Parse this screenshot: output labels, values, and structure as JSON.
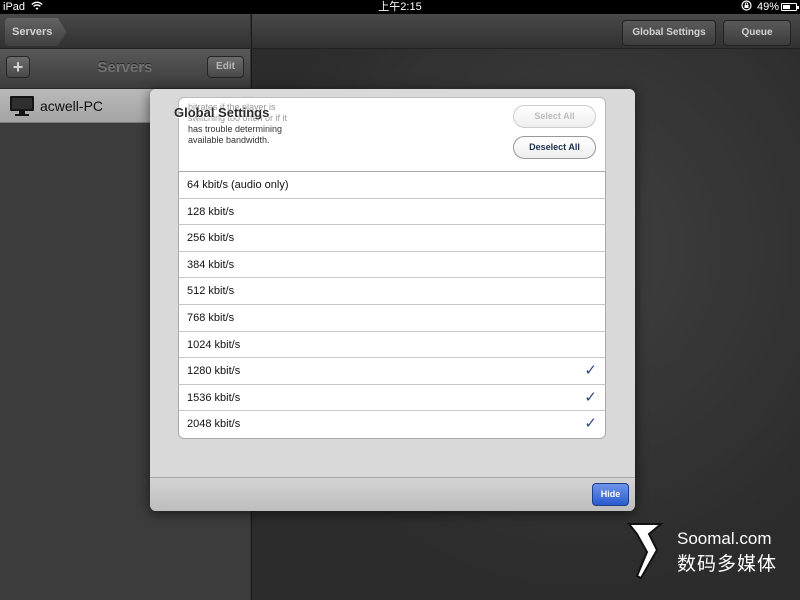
{
  "status_bar": {
    "device": "iPad",
    "time": "上午2:15",
    "battery": "49%",
    "battery_level": 0.49
  },
  "master": {
    "back_label": "Servers",
    "title": "Servers",
    "add_label": "+",
    "edit_label": "Edit",
    "servers": [
      {
        "name": "acwell-PC",
        "icon": "computer-icon"
      }
    ]
  },
  "detail": {
    "buttons": {
      "global_settings": "Global Settings",
      "queue": "Queue"
    }
  },
  "modal": {
    "title": "Global Settings",
    "hint_lines": [
      "bitrates if the player is",
      "switching too often or if it",
      "has trouble determining",
      "available bandwidth."
    ],
    "select_all": "Select All",
    "deselect_all": "Deselect All",
    "bitrates": [
      {
        "label": "64 kbit/s (audio only)",
        "checked": false
      },
      {
        "label": "128 kbit/s",
        "checked": false
      },
      {
        "label": "256 kbit/s",
        "checked": false
      },
      {
        "label": "384 kbit/s",
        "checked": false
      },
      {
        "label": "512 kbit/s",
        "checked": false
      },
      {
        "label": "768 kbit/s",
        "checked": false
      },
      {
        "label": "1024 kbit/s",
        "checked": false
      },
      {
        "label": "1280 kbit/s",
        "checked": true
      },
      {
        "label": "1536 kbit/s",
        "checked": true
      },
      {
        "label": "2048 kbit/s",
        "checked": true
      }
    ],
    "checkmark": "✓",
    "hide_label": "Hide"
  },
  "watermark": {
    "line1": "Soomal.com",
    "line2": "数码多媒体"
  }
}
